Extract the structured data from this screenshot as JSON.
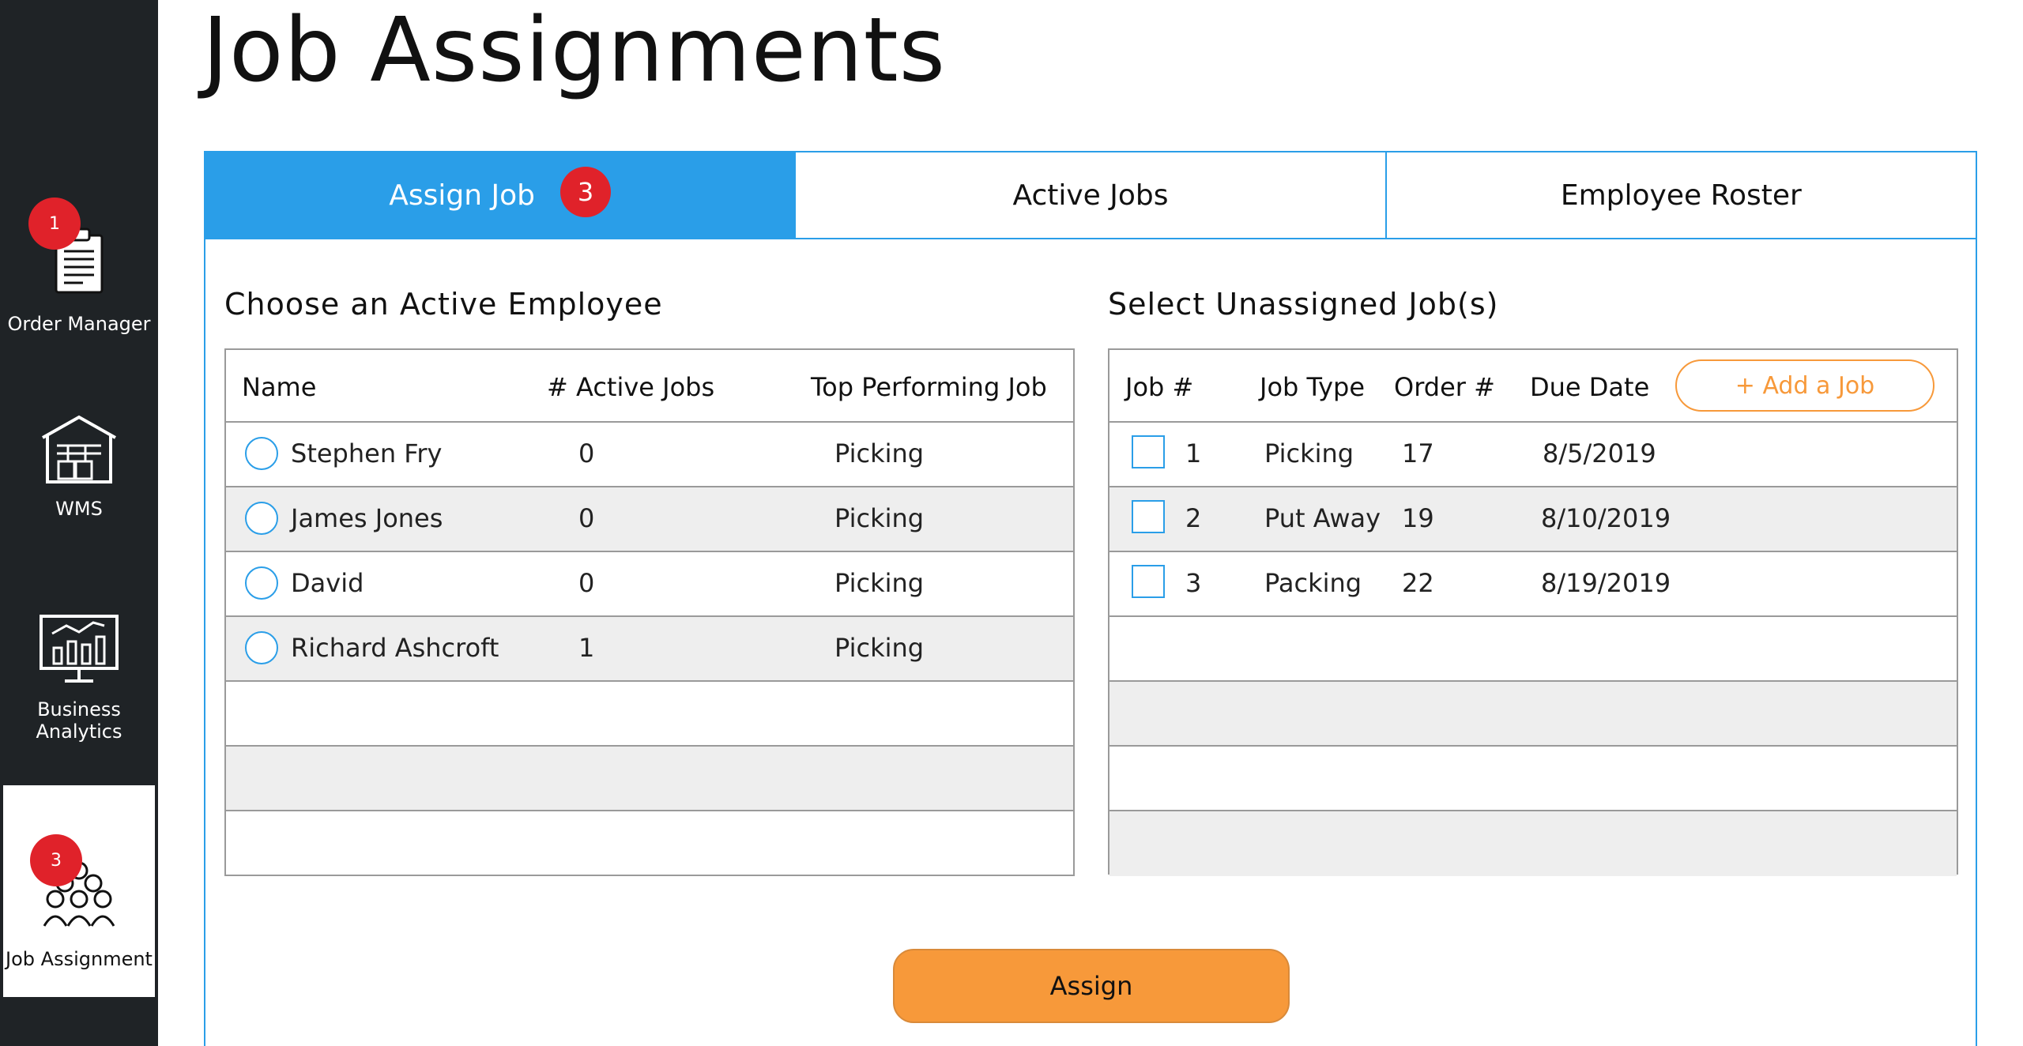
{
  "page": {
    "title": "Job Assignments"
  },
  "sidebar": {
    "items": [
      {
        "label": "Order Manager",
        "icon": "clipboard-icon",
        "badge": "1"
      },
      {
        "label": "WMS",
        "icon": "warehouse-icon"
      },
      {
        "label": "Business Analytics",
        "icon": "analytics-chart-icon"
      },
      {
        "label": "Job Assignment",
        "icon": "people-group-icon",
        "badge": "3"
      }
    ]
  },
  "tabs": [
    {
      "label": "Assign Job",
      "badge": "3"
    },
    {
      "label": "Active Jobs"
    },
    {
      "label": "Employee Roster"
    }
  ],
  "employees": {
    "heading": "Choose an Active Employee",
    "columns": [
      "Name",
      "# Active Jobs",
      "Top Performing Job"
    ],
    "rows": [
      {
        "name": "Stephen Fry",
        "active_jobs": "0",
        "top_job": "Picking"
      },
      {
        "name": "James Jones",
        "active_jobs": "0",
        "top_job": "Picking"
      },
      {
        "name": "David",
        "active_jobs": "0",
        "top_job": "Picking"
      },
      {
        "name": "Richard Ashcroft",
        "active_jobs": "1",
        "top_job": "Picking"
      }
    ]
  },
  "jobs": {
    "heading": "Select Unassigned Job(s)",
    "columns": [
      "Job #",
      "Job Type",
      "Order #",
      "Due Date"
    ],
    "add_button": "+ Add a Job",
    "rows": [
      {
        "job": "1",
        "type": "Picking",
        "order": "17",
        "due": "8/5/2019"
      },
      {
        "job": "2",
        "type": "Put Away",
        "order": "19",
        "due": "8/10/2019"
      },
      {
        "job": "3",
        "type": "Packing",
        "order": "22",
        "due": "8/19/2019"
      }
    ]
  },
  "assign_button": "Assign",
  "colors": {
    "accent": "#2a9ee8",
    "badge": "#e0222a",
    "action": "#f7993a",
    "sidebar": "#1f2326"
  }
}
